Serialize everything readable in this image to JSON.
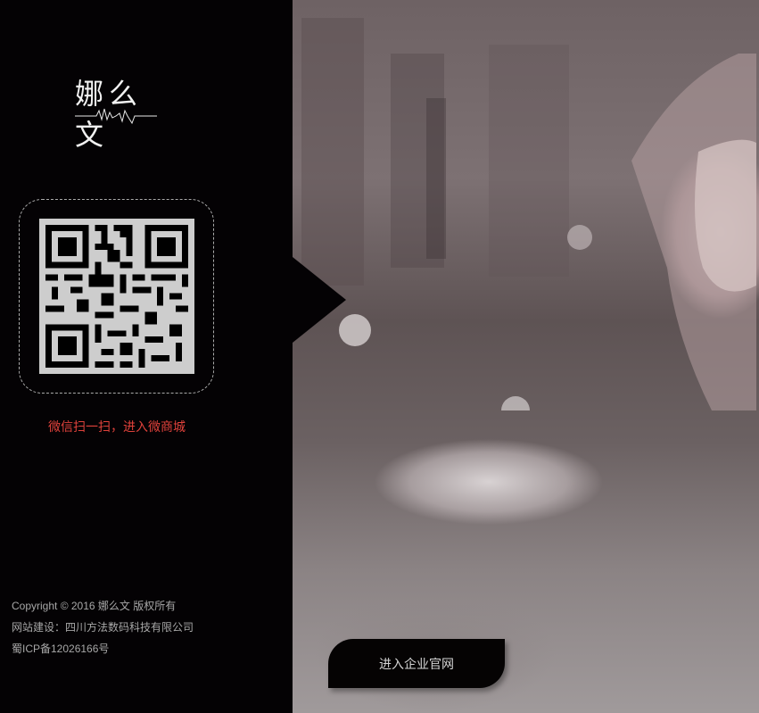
{
  "brand": {
    "logo_text": "娜么文",
    "logo_icon": "heartbeat-wave-icon"
  },
  "qr": {
    "caption": "微信扫一扫，进入微商城",
    "icon": "qr-code-icon"
  },
  "footer": {
    "copyright": "Copyright © 2016 娜么文 版权所有",
    "builder": "网站建设：四川方法数码科技有限公司",
    "icp": "蜀ICP备12026166号"
  },
  "cta": {
    "label": "进入企业官网"
  },
  "colors": {
    "sidebar_bg": "#040204",
    "caption": "#e0423b",
    "footer_text": "#a7a7a7"
  }
}
